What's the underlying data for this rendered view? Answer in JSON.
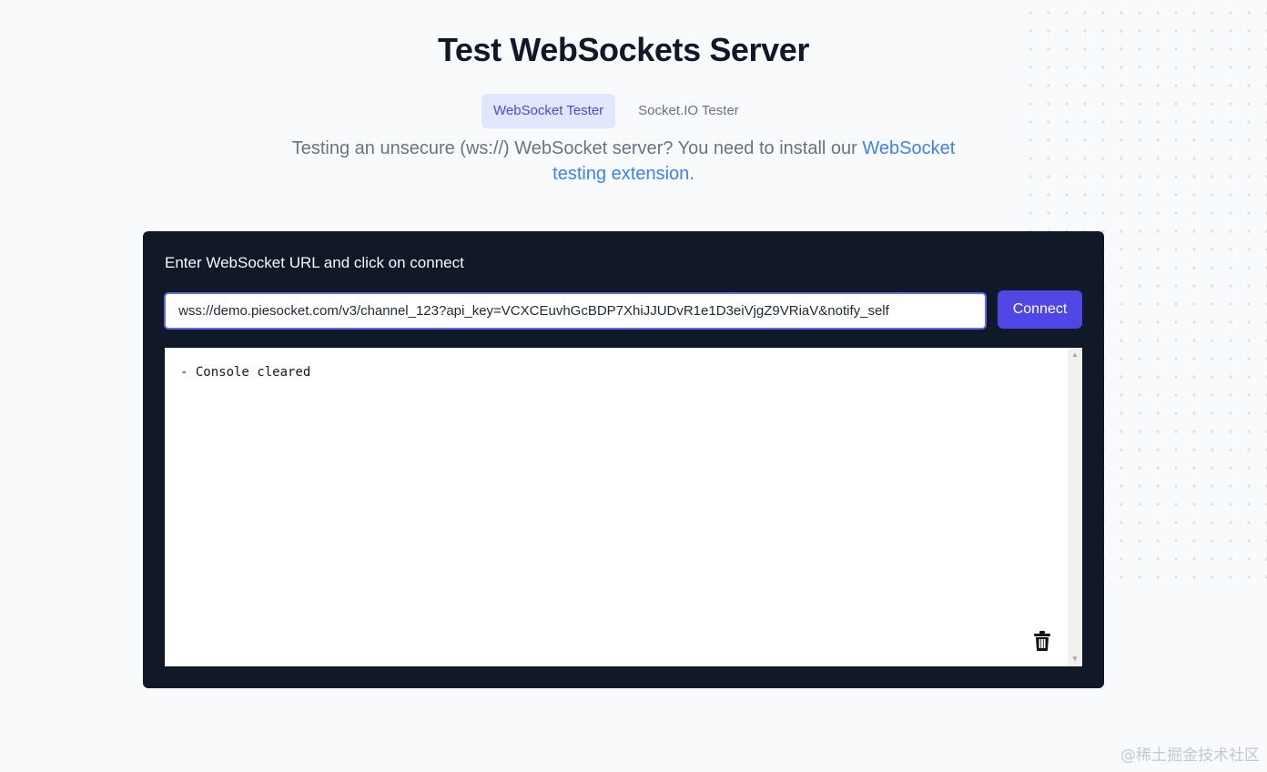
{
  "page": {
    "title": "Test WebSockets Server"
  },
  "tabs": [
    {
      "label": "WebSocket Tester",
      "active": true
    },
    {
      "label": "Socket.IO Tester",
      "active": false
    }
  ],
  "notice": {
    "text": "Testing an unsecure (ws://) WebSocket server? You need to install our ",
    "link_text": "WebSocket testing extension",
    "suffix": "."
  },
  "panel": {
    "label": "Enter WebSocket URL and click on connect",
    "url_value": "wss://demo.piesocket.com/v3/channel_123?api_key=VCXCEuvhGcBDP7XhiJJUDvR1e1D3eiVjgZ9VRiaV&notify_self",
    "connect_label": "Connect",
    "console_output": "- Console cleared",
    "clear_icon": "trash-icon"
  },
  "watermark": "@稀土掘金技术社区",
  "colors": {
    "accent": "#4f46e5",
    "tab_active_bg": "#e0e7ff",
    "link": "#3b82f6",
    "panel_bg": "#111827"
  }
}
